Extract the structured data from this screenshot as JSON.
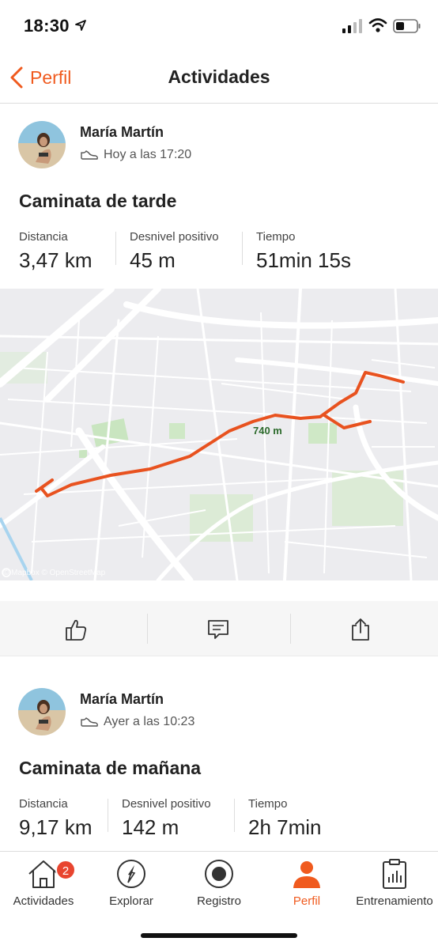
{
  "status": {
    "time": "18:30"
  },
  "nav": {
    "back_label": "Perfil",
    "title": "Actividades"
  },
  "activities": [
    {
      "athlete": "María Martín",
      "when": "Hoy a las 17:20",
      "title": "Caminata de tarde",
      "stats": [
        {
          "label": "Distancia",
          "value": "3,47 km"
        },
        {
          "label": "Desnivel positivo",
          "value": "45 m"
        },
        {
          "label": "Tiempo",
          "value": "51min 15s"
        }
      ],
      "map": {
        "marker": "740 m",
        "attribution": "© Mapbox © OpenStreetMap",
        "route_color": "#e8521f"
      }
    },
    {
      "athlete": "María Martín",
      "when": "Ayer a las 10:23",
      "title": "Caminata de mañana",
      "stats": [
        {
          "label": "Distancia",
          "value": "9,17 km"
        },
        {
          "label": "Desnivel positivo",
          "value": "142 m"
        },
        {
          "label": "Tiempo",
          "value": "2h 7min"
        }
      ]
    }
  ],
  "actions": {
    "like_icon": "thumbs-up-icon",
    "comment_icon": "comment-icon",
    "share_icon": "share-icon"
  },
  "tabs": [
    {
      "label": "Actividades",
      "icon": "home-icon",
      "badge": "2"
    },
    {
      "label": "Explorar",
      "icon": "compass-icon"
    },
    {
      "label": "Registro",
      "icon": "record-icon"
    },
    {
      "label": "Perfil",
      "icon": "profile-icon",
      "active": true
    },
    {
      "label": "Entrenamiento",
      "icon": "clipboard-chart-icon"
    }
  ],
  "colors": {
    "accent": "#f05a1e",
    "badge": "#e8452f"
  }
}
